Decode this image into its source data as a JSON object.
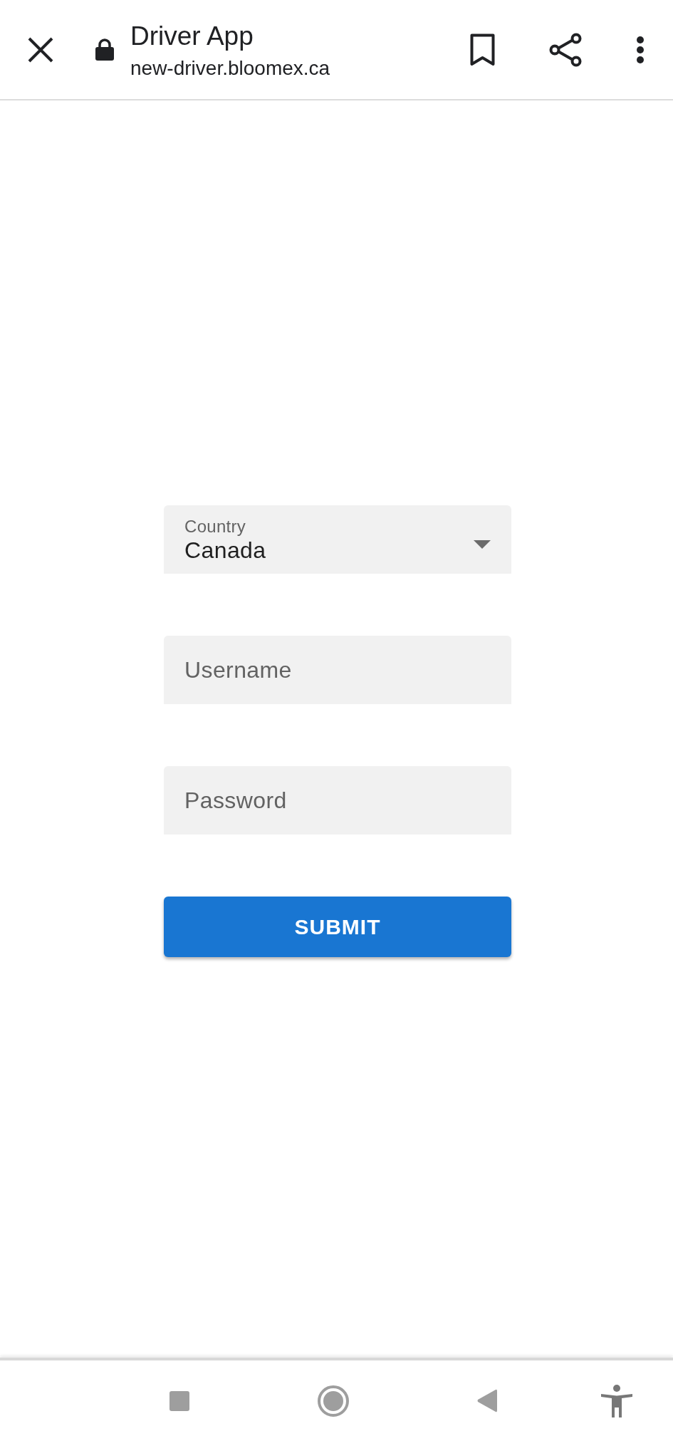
{
  "browser_bar": {
    "title": "Driver App",
    "url": "new-driver.bloomex.ca"
  },
  "form": {
    "country": {
      "label": "Country",
      "value": "Canada"
    },
    "fields": [
      {
        "placeholder": "Username"
      },
      {
        "placeholder": "Password"
      }
    ],
    "submit": {
      "label": "SUBMIT"
    }
  }
}
